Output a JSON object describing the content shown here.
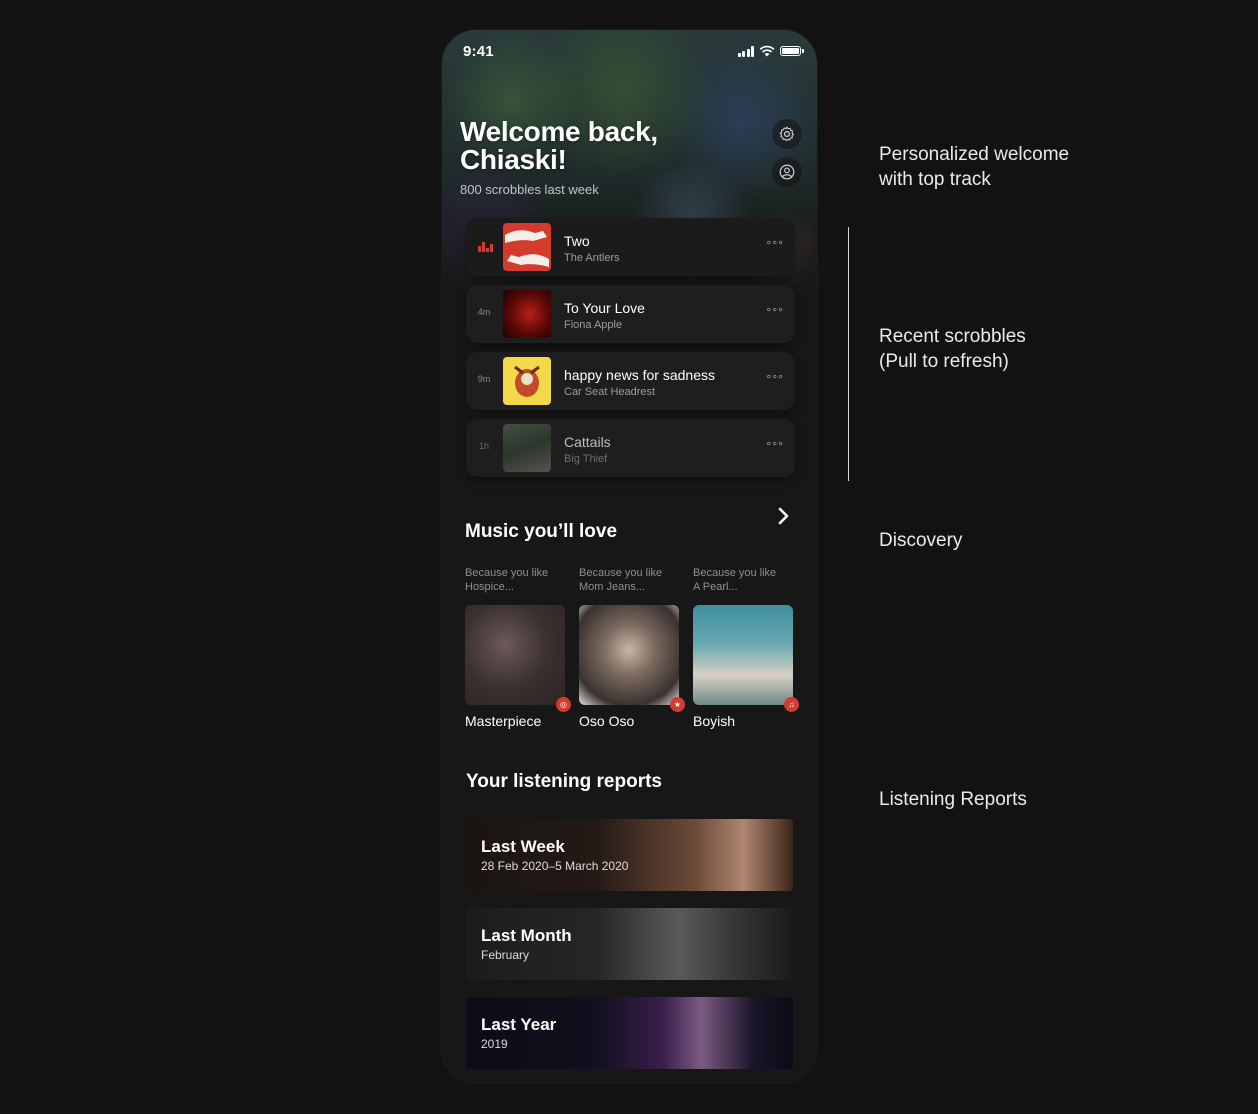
{
  "status_bar": {
    "time": "9:41"
  },
  "header": {
    "welcome_line1": "Welcome back,",
    "welcome_line2": "Chiaski!",
    "scrobbles_summary": "800 scrobbles last week"
  },
  "header_actions": [
    {
      "name": "settings",
      "icon": "gear-icon"
    },
    {
      "name": "profile",
      "icon": "user-icon"
    }
  ],
  "recent_scrobbles": [
    {
      "time": "",
      "now_playing": true,
      "title": "Two",
      "artist": "The Antlers",
      "more": "∘∘∘"
    },
    {
      "time": "4m",
      "title": "To Your Love",
      "artist": "Fiona Apple",
      "more": "∘∘∘"
    },
    {
      "time": "9m",
      "title": "happy news for sadness",
      "artist": "Car Seat Headrest",
      "more": "∘∘∘"
    },
    {
      "time": "1h",
      "title": "Cattails",
      "artist": "Big Thief",
      "more": "∘∘∘"
    }
  ],
  "discovery": {
    "title": "Music you’ll love",
    "items": [
      {
        "because_line1": "Because you like",
        "because_line2": "Hospice...",
        "name": "Masterpiece",
        "badge_icon": "vinyl-icon"
      },
      {
        "because_line1": "Because you like",
        "because_line2": "Mom Jeans...",
        "name": "Oso Oso",
        "badge_icon": "star-icon"
      },
      {
        "because_line1": "Because you like",
        "because_line2": "A Pearl...",
        "name": "Boyish",
        "badge_icon": "music-note-icon"
      }
    ]
  },
  "reports": {
    "title": "Your listening reports",
    "items": [
      {
        "title": "Last Week",
        "subtitle": "28 Feb 2020–5 March 2020"
      },
      {
        "title": "Last Month",
        "subtitle": "February"
      },
      {
        "title": "Last Year",
        "subtitle": "2019"
      }
    ]
  },
  "annotations": {
    "welcome": [
      "Personalized welcome",
      "with top track"
    ],
    "recent": [
      "Recent scrobbles",
      "(Pull to refresh)"
    ],
    "discovery": "Discovery",
    "reports": "Listening Reports"
  },
  "colors": {
    "accent": "#d43b2f",
    "background": "#121212",
    "card": "#1e1e1e"
  }
}
